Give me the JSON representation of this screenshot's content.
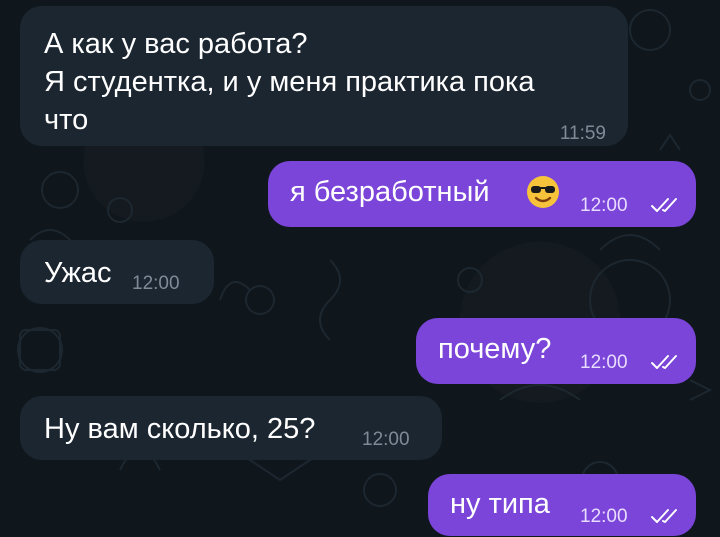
{
  "chat": {
    "messages": [
      {
        "direction": "incoming",
        "lines": [
          "А как у вас работа?",
          "Я студентка, и у меня практика пока",
          "что"
        ],
        "time": "11:59"
      },
      {
        "direction": "outgoing",
        "text": "я безработный",
        "emoji": "smiling-face-with-sunglasses-icon",
        "time": "12:00",
        "status": "read"
      },
      {
        "direction": "incoming",
        "text": "Ужас",
        "time": "12:00"
      },
      {
        "direction": "outgoing",
        "text": "почему?",
        "time": "12:00",
        "status": "read"
      },
      {
        "direction": "incoming",
        "text": "Ну вам сколько, 25?",
        "time": "12:00"
      },
      {
        "direction": "outgoing",
        "text": "ну типа",
        "time": "12:00",
        "status": "read"
      }
    ]
  },
  "colors": {
    "background": "#0f161c",
    "incoming_bubble": "#1b2631",
    "outgoing_bubble": "#7a45d8",
    "incoming_time": "#7f8a96",
    "outgoing_time": "#e8dcff"
  }
}
